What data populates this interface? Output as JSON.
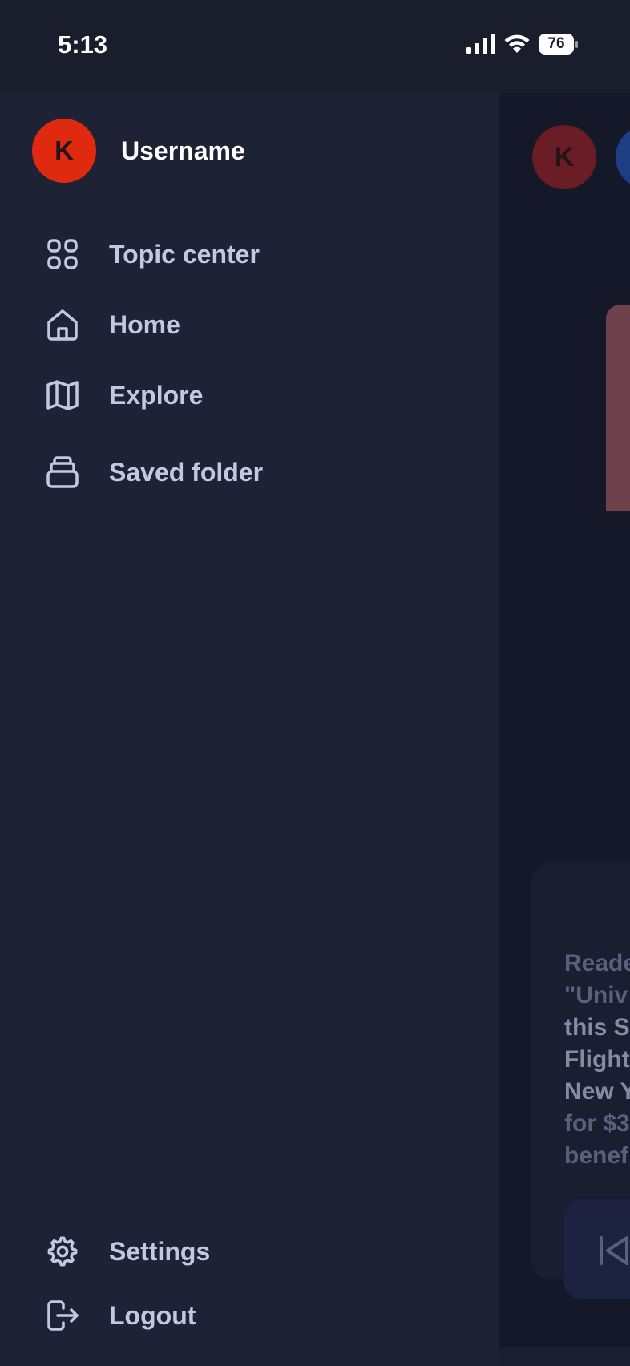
{
  "status_bar": {
    "time": "5:13",
    "battery": "76"
  },
  "user": {
    "avatar_initial": "K",
    "name": "Username"
  },
  "nav": {
    "topic_center": "Topic center",
    "home": "Home",
    "explore": "Explore",
    "saved_folder": "Saved folder",
    "settings": "Settings",
    "logout": "Logout"
  },
  "background": {
    "avatar_initial": "K",
    "text_lines": [
      "Reade",
      "\"Univ",
      "this S",
      "Flight",
      "New Y",
      "for $3",
      "benef"
    ]
  },
  "colors": {
    "drawer_bg": "#1e2235",
    "avatar": "#e02a10",
    "label": "#c5c8dd"
  }
}
